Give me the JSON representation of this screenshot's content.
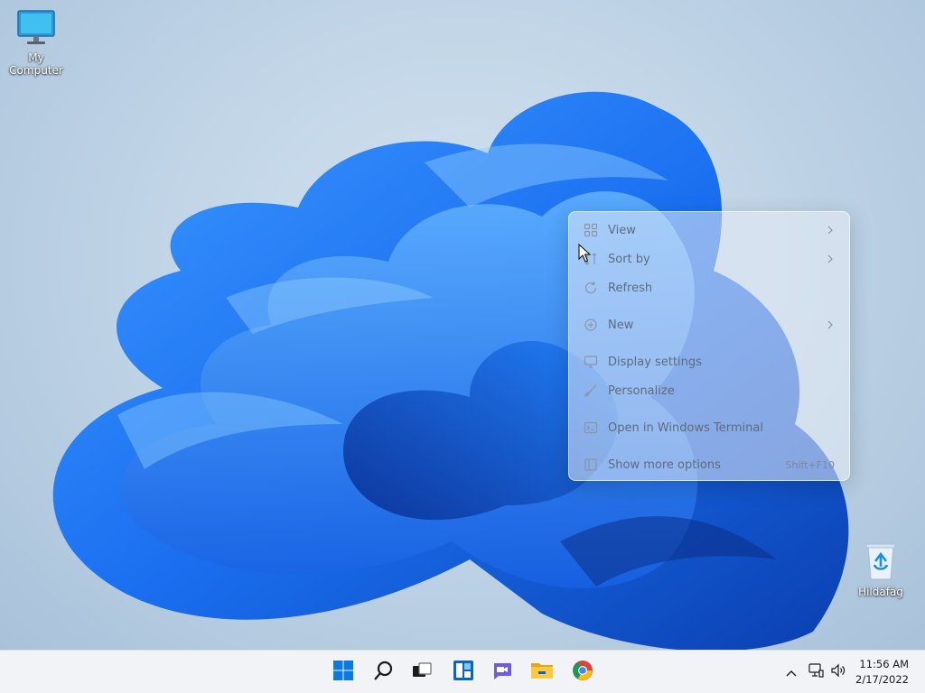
{
  "desktop": {
    "icons": [
      {
        "label": "My Computer",
        "icon": "monitor-icon"
      },
      {
        "label": "Hildáfág",
        "icon": "recycle-bin-icon"
      }
    ]
  },
  "context_menu": {
    "items": [
      {
        "label": "View",
        "icon": "grid-icon",
        "submenu": true
      },
      {
        "label": "Sort by",
        "icon": "sort-icon",
        "submenu": true
      },
      {
        "label": "Refresh",
        "icon": "refresh-icon"
      },
      {
        "label": "New",
        "icon": "plus-circle-icon",
        "submenu": true
      },
      {
        "label": "Display settings",
        "icon": "display-icon"
      },
      {
        "label": "Personalize",
        "icon": "brush-icon"
      },
      {
        "label": "Open in Windows Terminal",
        "icon": "terminal-icon"
      },
      {
        "label": "Show more options",
        "icon": "more-options-icon",
        "shortcut": "Shift+F10"
      }
    ]
  },
  "taskbar": {
    "apps": [
      "start-icon",
      "search-icon",
      "task-view-icon",
      "widgets-icon",
      "chat-icon",
      "file-explorer-icon",
      "chrome-icon"
    ],
    "tray": [
      "chevron-up-icon",
      "network-icon",
      "volume-icon"
    ],
    "clock": {
      "time": "11:56 AM",
      "date": "2/17/2022"
    }
  },
  "colors": {
    "accent": "#0a64d8",
    "taskbar_bg": "#f1f3f6",
    "menu_text": "#5f6b7d"
  }
}
